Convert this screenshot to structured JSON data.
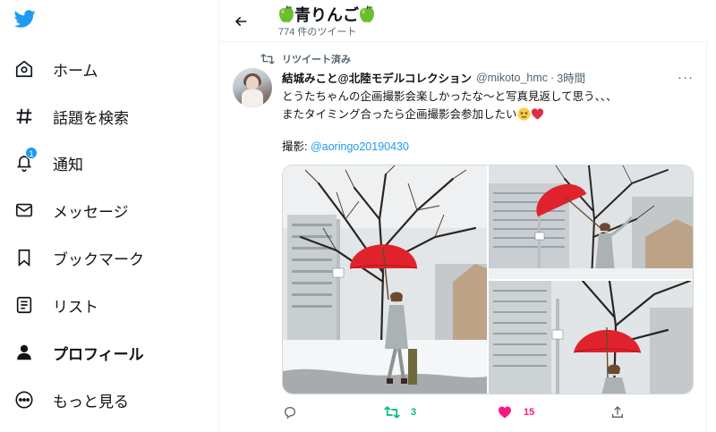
{
  "sidebar": {
    "logo_icon": "twitter-bird-icon",
    "items": [
      {
        "label": "ホーム",
        "icon": "home-icon"
      },
      {
        "label": "話題を検索",
        "icon": "hashtag-icon"
      },
      {
        "label": "通知",
        "icon": "bell-icon",
        "badge": "1"
      },
      {
        "label": "メッセージ",
        "icon": "mail-icon"
      },
      {
        "label": "ブックマーク",
        "icon": "bookmark-icon"
      },
      {
        "label": "リスト",
        "icon": "list-icon"
      },
      {
        "label": "プロフィール",
        "icon": "person-icon",
        "active": true
      },
      {
        "label": "もっと見る",
        "icon": "more-circle-icon"
      }
    ]
  },
  "header": {
    "back_icon": "arrow-left-icon",
    "name": "青りんご",
    "tweet_count": "774 件のツイート"
  },
  "tweet": {
    "retweet_label": "リツイート済み",
    "author_name": "結城みこと@北陸モデルコレクション",
    "handle": "@mikoto_hmc",
    "separator": "·",
    "time": "3時間",
    "more_label": "···",
    "text_line1": "とうたちゃんの企画撮影会楽しかったな〜と写真見返して思う、、、",
    "text_line2": "またタイミング合ったら企画撮影会参加したい",
    "credit_label": "撮影: ",
    "credit_mention": "@aoringo20190430",
    "actions": {
      "reply_count": "",
      "retweet_count": "3",
      "like_count": "15"
    }
  },
  "colors": {
    "accent": "#1d9bf0",
    "retweet_green": "#00ba7c",
    "like_pink": "#f91880",
    "text_secondary": "#536471",
    "umbrella_red": "#e0222c"
  }
}
